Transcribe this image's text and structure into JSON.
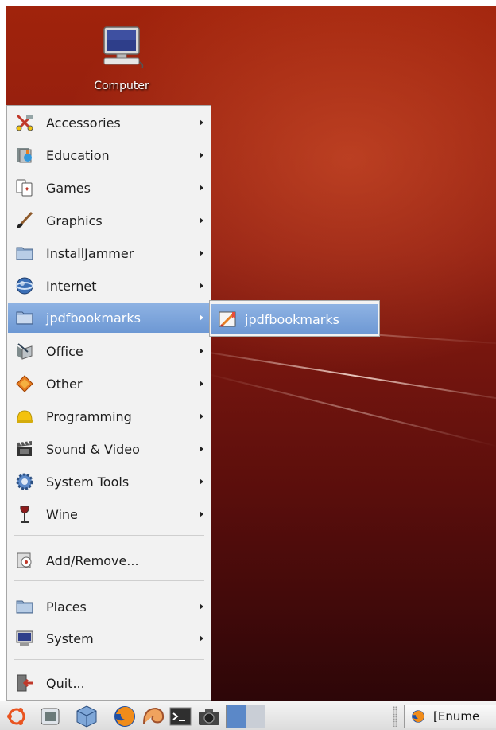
{
  "desktop": {
    "computer_icon_label": "Computer"
  },
  "menu": {
    "items": [
      {
        "label": "Accessories",
        "icon": "accessories-icon",
        "submenu": true
      },
      {
        "label": "Education",
        "icon": "education-icon",
        "submenu": true
      },
      {
        "label": "Games",
        "icon": "games-icon",
        "submenu": true
      },
      {
        "label": "Graphics",
        "icon": "graphics-icon",
        "submenu": true
      },
      {
        "label": "InstallJammer",
        "icon": "folder-icon",
        "submenu": true
      },
      {
        "label": "Internet",
        "icon": "internet-icon",
        "submenu": true
      },
      {
        "label": "jpdfbookmarks",
        "icon": "folder-icon",
        "submenu": true,
        "active": true
      },
      {
        "label": "Office",
        "icon": "office-icon",
        "submenu": true
      },
      {
        "label": "Other",
        "icon": "other-icon",
        "submenu": true
      },
      {
        "label": "Programming",
        "icon": "programming-icon",
        "submenu": true
      },
      {
        "label": "Sound & Video",
        "icon": "sound-video-icon",
        "submenu": true
      },
      {
        "label": "System Tools",
        "icon": "system-tools-icon",
        "submenu": true
      },
      {
        "label": "Wine",
        "icon": "wine-icon",
        "submenu": true
      }
    ],
    "add_remove": {
      "label": "Add/Remove...",
      "icon": "add-remove-icon"
    },
    "places": {
      "label": "Places",
      "icon": "folder-icon",
      "submenu": true
    },
    "system": {
      "label": "System",
      "icon": "monitor-icon",
      "submenu": true
    },
    "quit": {
      "label": "Quit...",
      "icon": "quit-icon"
    }
  },
  "submenu": {
    "items": [
      {
        "label": "jpdfbookmarks",
        "icon": "jpdfbookmarks-app-icon"
      }
    ]
  },
  "taskbar": {
    "launchers": [
      "ubuntu-logo-icon",
      "show-desktop-icon",
      "cube-icon",
      "firefox-icon",
      "nautilus-icon",
      "terminal-icon",
      "camera-icon"
    ],
    "workspaces": [
      "workspace-1",
      "workspace-2"
    ],
    "task_label": "[Enume"
  },
  "colors": {
    "highlight": "#7aa2d9",
    "menu_bg": "#f2f2f2",
    "desktop_top": "#a0230c",
    "desktop_bottom": "#2d0608"
  }
}
